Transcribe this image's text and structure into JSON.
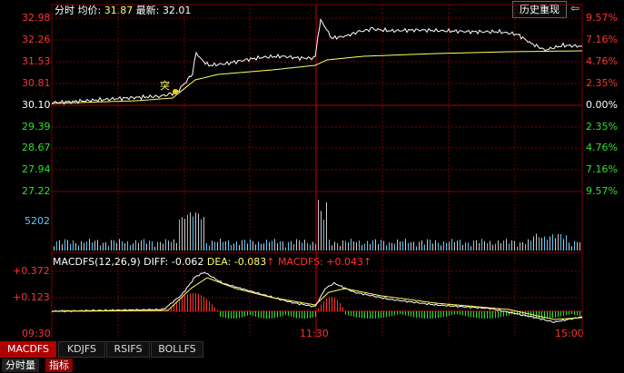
{
  "header": {
    "period_label": "分时",
    "avg_label": "均价:",
    "avg_value": "31.87",
    "last_label": "最新:",
    "last_value": "32.01",
    "replay_label": "历史重现",
    "arrow_glyph": "⇦"
  },
  "price_axis": {
    "left_up": [
      "32.98",
      "32.26",
      "31.53",
      "30.81"
    ],
    "left_mid": "30.10",
    "left_down": [
      "29.39",
      "28.67",
      "27.94",
      "27.22"
    ],
    "right_up": [
      "9.57%",
      "7.16%",
      "4.76%",
      "2.35%"
    ],
    "right_mid": "0.00%",
    "right_down": [
      "2.35%",
      "4.76%",
      "7.16%",
      "9.57%"
    ]
  },
  "volume_axis": {
    "label": "5202"
  },
  "macd": {
    "title": "MACDFS(12,26,9)",
    "diff_label": "DIFF: -0.062",
    "dea_label": "DEA: -0.083",
    "dea_arrow": "↑",
    "macdfs_label": "MACDFS: +0.043",
    "macdfs_arrow": "↑",
    "axis_top": "+0.372",
    "axis_mid": "+0.123"
  },
  "time_axis": [
    "09:30",
    "11:30",
    "15:00"
  ],
  "marker": {
    "text": "突"
  },
  "tabs": [
    "MACDFS",
    "KDJFS",
    "RSIFS",
    "BOLLFS"
  ],
  "sub_tabs": [
    "分时量",
    "指标"
  ],
  "colors": {
    "up": "#ff3232",
    "down": "#2ee02e",
    "grid": "#7a0000",
    "price_line": "#ffffff",
    "avg_line": "#ffff66"
  }
}
